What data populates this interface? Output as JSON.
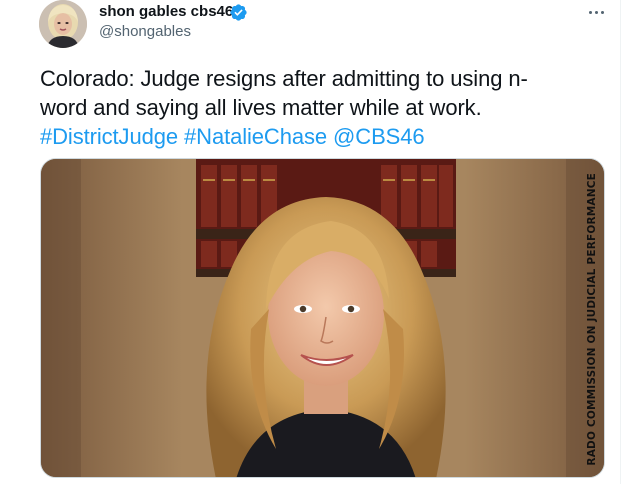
{
  "tweet": {
    "display_name": "shon gables cbs46",
    "handle": "@shongables",
    "text_lines": [
      "Colorado: Judge resigns after admitting to using n-",
      "word and saying all lives matter while at work."
    ],
    "hashtags": [
      "#DistrictJudge",
      "#NatalieChase",
      "@CBS46"
    ],
    "image_watermark": "RADO COMMISSION ON JUDICIAL PERFORMANCE"
  },
  "icons": {
    "verified": "verified-badge-icon",
    "more": "more-options-icon"
  },
  "colors": {
    "link": "#1d9bf0",
    "text": "#0f1419",
    "secondary": "#536471"
  }
}
